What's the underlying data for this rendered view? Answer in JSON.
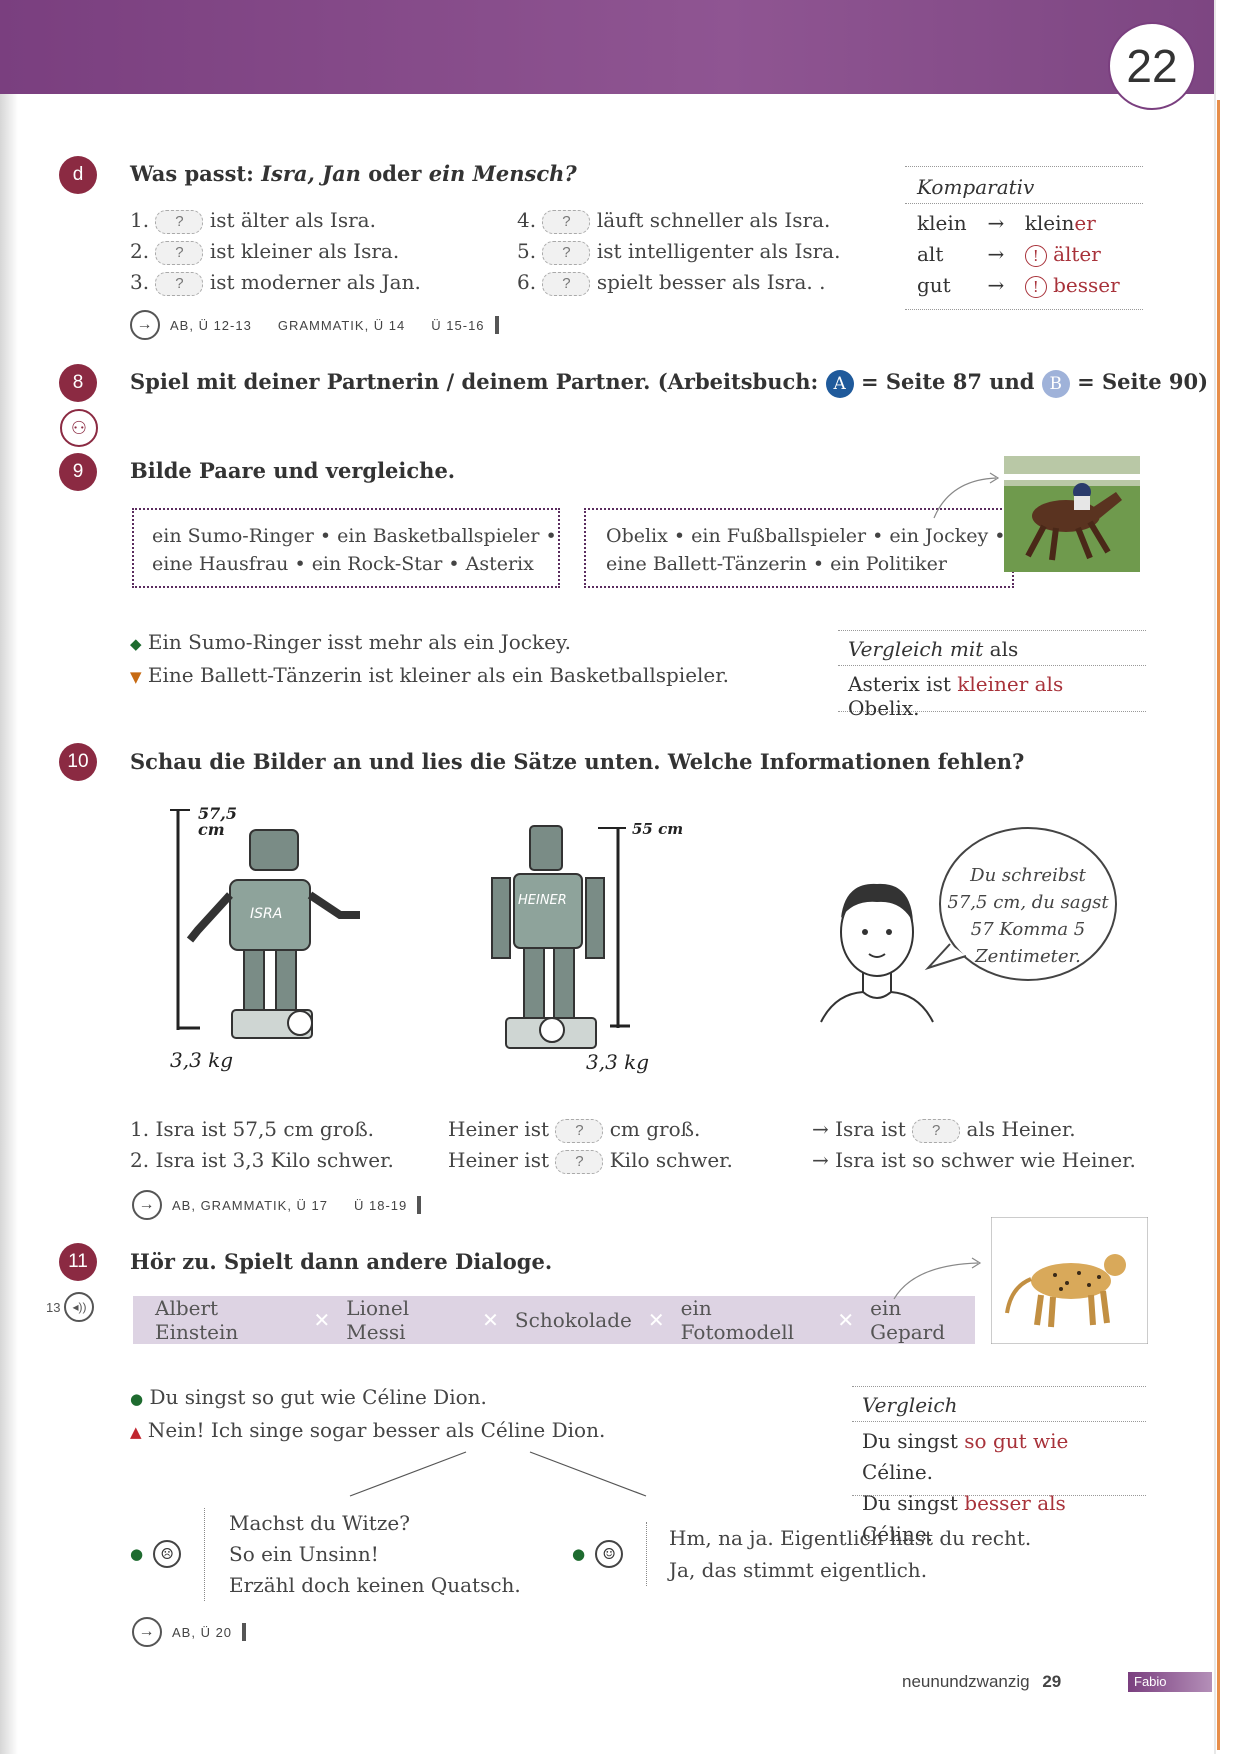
{
  "header": {
    "page_badge": "22"
  },
  "section_d": {
    "badge": "d",
    "title_prefix": "Was passt: ",
    "title_italic": "Isra, Jan",
    "title_mid": " oder ",
    "title_italic2": "ein Mensch?",
    "items_left": [
      {
        "n": "1.",
        "text": "ist älter als Isra."
      },
      {
        "n": "2.",
        "text": "ist kleiner als Isra."
      },
      {
        "n": "3.",
        "text": "ist moderner als Jan."
      }
    ],
    "items_right": [
      {
        "n": "4.",
        "text": "läuft schneller als Isra."
      },
      {
        "n": "5.",
        "text": "ist intelligenter als Isra."
      },
      {
        "n": "6.",
        "text": "spielt besser als Isra. ."
      }
    ],
    "placeholder": "?",
    "refs": [
      "AB, Ü 12-13",
      "GRAMMATIK, Ü 14",
      "Ü 15-16"
    ]
  },
  "komparativ": {
    "title": "Komparativ",
    "rows": [
      {
        "base": "klein",
        "arrow": "→",
        "stem": "klein",
        "suffix": "er",
        "mark": ""
      },
      {
        "base": "alt",
        "arrow": "→",
        "stem": "",
        "suffix": "älter",
        "mark": "!"
      },
      {
        "base": "gut",
        "arrow": "→",
        "stem": "",
        "suffix": "besser",
        "mark": "!"
      }
    ]
  },
  "section_8": {
    "badge": "8",
    "text": "Spiel mit deiner Partnerin / deinem Partner. (Arbeitsbuch:",
    "a_label": "A",
    "a_text": "= Seite 87 und",
    "b_label": "B",
    "b_text": "= Seite 90)"
  },
  "section_9": {
    "badge": "9",
    "title": "Bilde Paare und vergleiche.",
    "box_left": [
      "ein Sumo-Ringer • ein Basketballspieler •",
      "eine Hausfrau • ein Rock-Star • Asterix"
    ],
    "box_right": [
      "Obelix • ein Fußballspieler • ein Jockey •",
      "eine Ballett-Tänzerin • ein Politiker"
    ],
    "examples": [
      {
        "marker": "◆",
        "text": "Ein Sumo-Ringer isst mehr als ein Jockey."
      },
      {
        "marker": "▼",
        "text": "Eine Ballett-Tänzerin ist kleiner als ein Basketballspieler."
      }
    ],
    "grammar": {
      "title_italic": "Vergleich mit",
      "title_plain": " als",
      "example_pre": "Asterix ist ",
      "example_red": "kleiner als",
      "example_post": " Obelix."
    }
  },
  "section_10": {
    "badge": "10",
    "title": "Schau die Bilder an und lies die Sätze unten. Welche Informationen fehlen?",
    "robot1": {
      "height_num": "57,5",
      "height_unit": "cm",
      "weight": "3,3 kg",
      "label": "ISRA"
    },
    "robot2": {
      "height": "55 cm",
      "weight": "3,3 kg",
      "label": "HEINER"
    },
    "speech": [
      "Du schreibst",
      "57,5 cm, du sagst",
      "57 Komma 5",
      "Zentimeter."
    ],
    "sentences_col1": [
      "1. Isra ist 57,5 cm groß.",
      "2. Isra ist 3,3 Kilo schwer."
    ],
    "sentences_col2": [
      {
        "pre": "Heiner ist",
        "post": "cm groß."
      },
      {
        "pre": "Heiner ist",
        "post": "Kilo schwer."
      }
    ],
    "sentences_col3": [
      {
        "pre": "Isra ist",
        "post": "als Heiner.",
        "pill": true
      },
      {
        "pre": "Isra ist so schwer wie Heiner.",
        "post": "",
        "pill": false
      }
    ],
    "arrow": "→",
    "refs": [
      "AB, GRAMMATIK, Ü 17",
      "Ü 18-19"
    ]
  },
  "section_11": {
    "badge": "11",
    "audio_track": "13",
    "title": "Hör zu. Spielt dann andere Dialoge.",
    "words": [
      "Albert Einstein",
      "Lionel Messi",
      "Schokolade",
      "ein Fotomodell",
      "ein Gepard"
    ],
    "dialog": [
      {
        "marker": "●",
        "text": "Du singst so gut wie Céline Dion."
      },
      {
        "marker": "▲",
        "text": "Nein! Ich singe sogar besser als Céline Dion."
      }
    ],
    "grammar": {
      "title": "Vergleich",
      "line1_pre": "Du singst ",
      "line1_red": "so gut wie",
      "line1_post": " Céline.",
      "line2_pre": "Du singst ",
      "line2_red": "besser als",
      "line2_post": " Céline."
    },
    "negative": [
      "Machst du Witze?",
      "So ein Unsinn!",
      "Erzähl doch keinen Quatsch."
    ],
    "positive": [
      "Hm, na ja. Eigentlich hast du recht.",
      "Ja, das stimmt eigentlich."
    ],
    "refs": [
      "AB, Ü 20"
    ]
  },
  "footer": {
    "page_word": "neunundzwanzig",
    "page_num": "29",
    "tag": "Fabio"
  },
  "colors": {
    "purple": "#7a3f7f",
    "badge_red": "#8b2a42",
    "accent_red": "#a8323a"
  }
}
